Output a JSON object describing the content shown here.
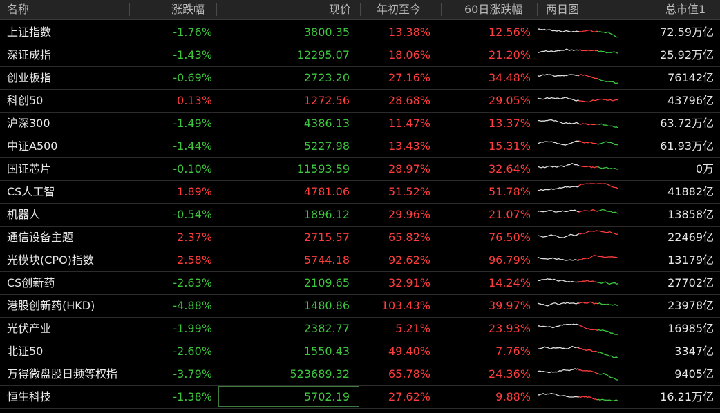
{
  "header": {
    "name": "名称",
    "change": "涨跌幅",
    "price": "现价",
    "ytd": "年初至今",
    "d60": "60日涨跌幅",
    "spark": "两日图",
    "cap": "总市值1"
  },
  "colors": {
    "up": "#ff3d3d",
    "down": "#3ec63e",
    "neutral": "#e0e0e0"
  },
  "rows": [
    {
      "name": "上证指数",
      "change": "-1.76%",
      "price": "3800.35",
      "ytd": "13.38%",
      "d60": "12.56%",
      "cap": "72.59万亿",
      "c": -1.76,
      "y": 13.38,
      "s": 12.56
    },
    {
      "name": "深证成指",
      "change": "-1.43%",
      "price": "12295.07",
      "ytd": "18.06%",
      "d60": "21.20%",
      "cap": "25.92万亿",
      "c": -1.43,
      "y": 18.06,
      "s": 21.2
    },
    {
      "name": "创业板指",
      "change": "-0.69%",
      "price": "2723.20",
      "ytd": "27.16%",
      "d60": "34.48%",
      "cap": "76142亿",
      "c": -0.69,
      "y": 27.16,
      "s": 34.48
    },
    {
      "name": "科创50",
      "change": "0.13%",
      "price": "1272.56",
      "ytd": "28.68%",
      "d60": "29.05%",
      "cap": "43796亿",
      "c": 0.13,
      "y": 28.68,
      "s": 29.05
    },
    {
      "name": "沪深300",
      "change": "-1.49%",
      "price": "4386.13",
      "ytd": "11.47%",
      "d60": "13.37%",
      "cap": "63.72万亿",
      "c": -1.49,
      "y": 11.47,
      "s": 13.37
    },
    {
      "name": "中证A500",
      "change": "-1.44%",
      "price": "5227.98",
      "ytd": "13.43%",
      "d60": "15.31%",
      "cap": "61.93万亿",
      "c": -1.44,
      "y": 13.43,
      "s": 15.31
    },
    {
      "name": "国证芯片",
      "change": "-0.10%",
      "price": "11593.59",
      "ytd": "28.97%",
      "d60": "32.64%",
      "cap": "0万",
      "c": -0.1,
      "y": 28.97,
      "s": 32.64
    },
    {
      "name": "CS人工智",
      "change": "1.89%",
      "price": "4781.06",
      "ytd": "51.52%",
      "d60": "51.78%",
      "cap": "41882亿",
      "c": 1.89,
      "y": 51.52,
      "s": 51.78
    },
    {
      "name": "机器人",
      "change": "-0.54%",
      "price": "1896.12",
      "ytd": "29.96%",
      "d60": "21.07%",
      "cap": "13858亿",
      "c": -0.54,
      "y": 29.96,
      "s": 21.07
    },
    {
      "name": "通信设备主题",
      "change": "2.37%",
      "price": "2715.57",
      "ytd": "65.82%",
      "d60": "76.50%",
      "cap": "22469亿",
      "c": 2.37,
      "y": 65.82,
      "s": 76.5
    },
    {
      "name": "光模块(CPO)指数",
      "change": "2.58%",
      "price": "5744.18",
      "ytd": "92.62%",
      "d60": "96.79%",
      "cap": "13179亿",
      "c": 2.58,
      "y": 92.62,
      "s": 96.79
    },
    {
      "name": "CS创新药",
      "change": "-2.63%",
      "price": "2109.65",
      "ytd": "32.91%",
      "d60": "14.24%",
      "cap": "27702亿",
      "c": -2.63,
      "y": 32.91,
      "s": 14.24
    },
    {
      "name": "港股创新药(HKD)",
      "change": "-4.88%",
      "price": "1480.86",
      "ytd": "103.43%",
      "d60": "39.97%",
      "cap": "23978亿",
      "c": -4.88,
      "y": 103.43,
      "s": 39.97
    },
    {
      "name": "光伏产业",
      "change": "-1.99%",
      "price": "2382.77",
      "ytd": "5.21%",
      "d60": "23.93%",
      "cap": "16985亿",
      "c": -1.99,
      "y": 5.21,
      "s": 23.93
    },
    {
      "name": "北证50",
      "change": "-2.60%",
      "price": "1550.43",
      "ytd": "49.40%",
      "d60": "7.76%",
      "cap": "3347亿",
      "c": -2.6,
      "y": 49.4,
      "s": 7.76
    },
    {
      "name": "万得微盘股日频等权指",
      "change": "-3.79%",
      "price": "523689.32",
      "ytd": "65.78%",
      "d60": "24.36%",
      "cap": "9405亿",
      "c": -3.79,
      "y": 65.78,
      "s": 24.36
    },
    {
      "name": "恒生科技",
      "change": "-1.38%",
      "price": "5702.19",
      "ytd": "27.62%",
      "d60": "9.88%",
      "cap": "16.21万亿",
      "c": -1.38,
      "y": 27.62,
      "s": 9.88,
      "selected": true
    }
  ]
}
